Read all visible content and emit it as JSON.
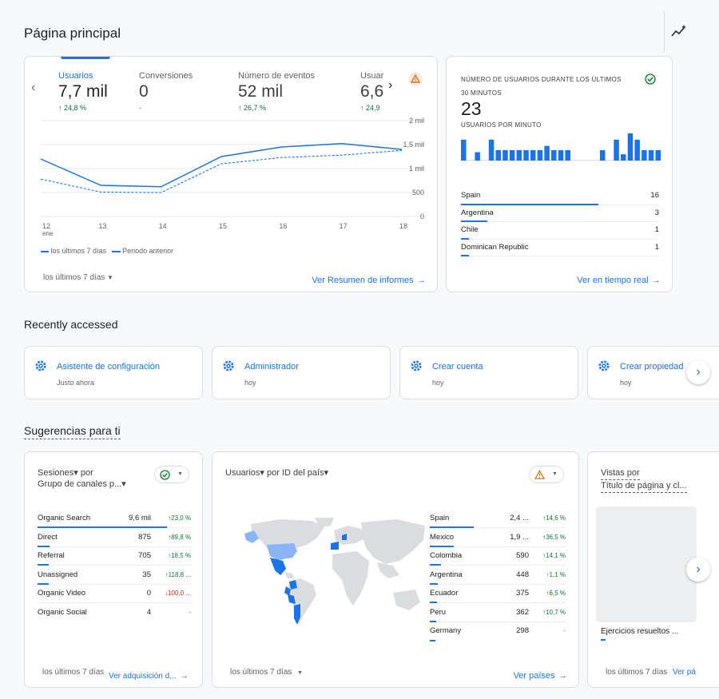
{
  "page_title": "Página principal",
  "overview": {
    "tabs": [
      {
        "label": "Usuarios",
        "value": "7,7 mil",
        "change": "24,8 %"
      },
      {
        "label": "Conversiones",
        "value": "0",
        "change": "-"
      },
      {
        "label": "Número de eventos",
        "value": "52 mil",
        "change": "26,7 %"
      },
      {
        "label": "Usuar",
        "value": "6,6",
        "change": "24,9"
      }
    ],
    "legend_current": "los últimos 7 días",
    "legend_previous": "Periodo anterior",
    "date_range": "los últimos 7 días",
    "view_link": "Ver Resumen de informes"
  },
  "chart_data": {
    "type": "line",
    "x": [
      "12 ene",
      "13",
      "14",
      "15",
      "16",
      "17",
      "18"
    ],
    "x_tick_labels": [
      "12",
      "13",
      "14",
      "15",
      "16",
      "17",
      "18"
    ],
    "x_sub_label": "ene",
    "y_ticks": [
      "2 mil",
      "1,5 mil",
      "1 mil",
      "500",
      "0"
    ],
    "ylim": [
      0,
      2000
    ],
    "series": [
      {
        "name": "los últimos 7 días",
        "values": [
          1200,
          650,
          620,
          1250,
          1450,
          1520,
          1400
        ],
        "color": "#1a73e8",
        "style": "solid"
      },
      {
        "name": "Periodo anterior",
        "values": [
          780,
          510,
          500,
          1100,
          1230,
          1280,
          1380
        ],
        "color": "#1a73e8",
        "style": "dashed"
      }
    ]
  },
  "realtime": {
    "title_line1": "NÚMERO DE USUARIOS DURANTE LOS ÚLTIMOS",
    "title_line2": "30 MINUTOS",
    "value": "23",
    "per_minute_label": "USUARIOS POR MINUTO",
    "bars": [
      1,
      0,
      0.4,
      0,
      1,
      0.5,
      0.5,
      0.5,
      0.5,
      0.5,
      0.5,
      0.5,
      0.7,
      0.5,
      0.5,
      0.5,
      0,
      0,
      0,
      0,
      0.5,
      0,
      1,
      0.3,
      1.3,
      1,
      0.5,
      0.5,
      0.5
    ],
    "countries": [
      {
        "name": "Spain",
        "value": "16",
        "share": 1.0
      },
      {
        "name": "Argentina",
        "value": "3",
        "share": 0.19
      },
      {
        "name": "Chile",
        "value": "1",
        "share": 0.06
      },
      {
        "name": "Dominican Republic",
        "value": "1",
        "share": 0.06
      }
    ],
    "view_link": "Ver en tiempo real"
  },
  "recently_accessed": {
    "heading": "Recently accessed",
    "items": [
      {
        "title": "Asistente de configuración",
        "sub": "Justo ahora"
      },
      {
        "title": "Administrador",
        "sub": "hoy"
      },
      {
        "title": "Crear cuenta",
        "sub": "hoy"
      },
      {
        "title": "Crear propiedad",
        "sub": "hoy"
      }
    ]
  },
  "suggestions": {
    "heading": "Sugerencias para ti",
    "sessions": {
      "title_line1": "Sesiones▾ por",
      "title_line2": "Grupo de canales p...▾",
      "rows": [
        {
          "name": "Organic Search",
          "value": "9,6 mil",
          "change": "↑23,0 %",
          "dir": "up",
          "share": 1.0
        },
        {
          "name": "Direct",
          "value": "875",
          "change": "↑89,8 %",
          "dir": "up",
          "share": 0.09
        },
        {
          "name": "Referral",
          "value": "705",
          "change": "↑18,5 %",
          "dir": "up",
          "share": 0.07
        },
        {
          "name": "Unassigned",
          "value": "35",
          "change": "↑118,8 ...",
          "dir": "up",
          "share": 0.005
        },
        {
          "name": "Organic Video",
          "value": "0",
          "change": "↓100,0 ...",
          "dir": "down",
          "share": 0
        },
        {
          "name": "Organic Social",
          "value": "4",
          "change": "-",
          "dir": "none",
          "share": 0
        }
      ],
      "date_range": "los últimos 7 días",
      "view_link": "Ver adquisición d..."
    },
    "countries": {
      "title": "Usuarios▾ por ID del país▾",
      "rows": [
        {
          "name": "Spain",
          "value": "2,4 ...",
          "change": "↑14,6 %",
          "share": 1.0
        },
        {
          "name": "Mexico",
          "value": "1,9 ...",
          "change": "↑36,5 %",
          "share": 0.55
        },
        {
          "name": "Colombia",
          "value": "590",
          "change": "↑14,1 %",
          "share": 0.25
        },
        {
          "name": "Argentina",
          "value": "448",
          "change": "↑1,1 %",
          "share": 0.19
        },
        {
          "name": "Ecuador",
          "value": "375",
          "change": "↑6,5 %",
          "share": 0.16
        },
        {
          "name": "Peru",
          "value": "362",
          "change": "↑10,7 %",
          "share": 0.15
        },
        {
          "name": "Germany",
          "value": "298",
          "change": "-",
          "share": 0.12
        }
      ],
      "date_range": "los últimos 7 días",
      "view_link": "Ver países"
    },
    "views": {
      "title_line1": "Vistas por",
      "title_line2": "Título de página y cl...",
      "row_label": "Ejercicios resueltos ...",
      "date_range": "los últimos 7 días",
      "view_link": "Ver pá"
    }
  },
  "colors": {
    "accent": "#1a73e8",
    "positive": "#137333",
    "negative": "#c5221f",
    "warning": "#e37400",
    "map_light": "#dadce0",
    "map_mid": "#8ab4f8"
  }
}
